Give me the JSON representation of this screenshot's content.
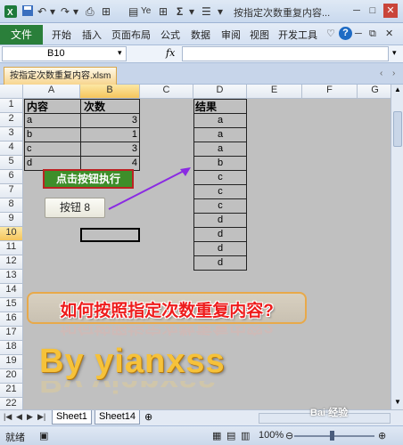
{
  "title_bar": {
    "title": "按指定次数重复内容...",
    "quick_access": [
      "save-icon",
      "undo-icon",
      "redo-icon",
      "print-preview-icon",
      "grid-icon",
      "table-icon",
      "sort-icon",
      "sum-icon",
      "filter-icon"
    ],
    "sigma": "Σ",
    "ye": "Ye"
  },
  "ribbon": {
    "file": "文件",
    "tabs": [
      "开始",
      "插入",
      "页面布局",
      "公式",
      "数据",
      "审阅",
      "视图",
      "开发工具"
    ],
    "help": "?"
  },
  "formula_bar": {
    "name_box": "B10",
    "fx": "fx",
    "value": ""
  },
  "workbook_tab": "按指定次数重复内容.xlsm",
  "columns": [
    "A",
    "B",
    "C",
    "D",
    "E",
    "F",
    "G"
  ],
  "rows": [
    "1",
    "2",
    "3",
    "4",
    "5",
    "6",
    "7",
    "8",
    "9",
    "10",
    "11",
    "12",
    "13",
    "14",
    "15",
    "16",
    "17",
    "18",
    "19",
    "20",
    "21",
    "22"
  ],
  "cells": {
    "A1": "内容",
    "B1": "次数",
    "A2": "a",
    "B2": "3",
    "A3": "b",
    "B3": "1",
    "A4": "c",
    "B4": "3",
    "A5": "d",
    "B5": "4",
    "D1": "结果",
    "D_values": [
      "a",
      "a",
      "a",
      "b",
      "c",
      "c",
      "c",
      "d",
      "d",
      "d",
      "d"
    ]
  },
  "buttons": {
    "run_label": "点击按钮执行",
    "form_button": "按钮 8"
  },
  "banner": "如何按照指定次数重复内容?",
  "byline": "By  yianxss",
  "sheet_tabs": [
    "Sheet1",
    "Sheet14"
  ],
  "status": {
    "ready": "就绪",
    "zoom": "100%",
    "watermark": "Bai 经验"
  },
  "colors": {
    "file_tab": "#2a7f3a",
    "accent_orange": "#f5c55c",
    "banner_text": "#ee1c1c",
    "byline": "#f6c23a",
    "arrow": "#8a2be2"
  }
}
